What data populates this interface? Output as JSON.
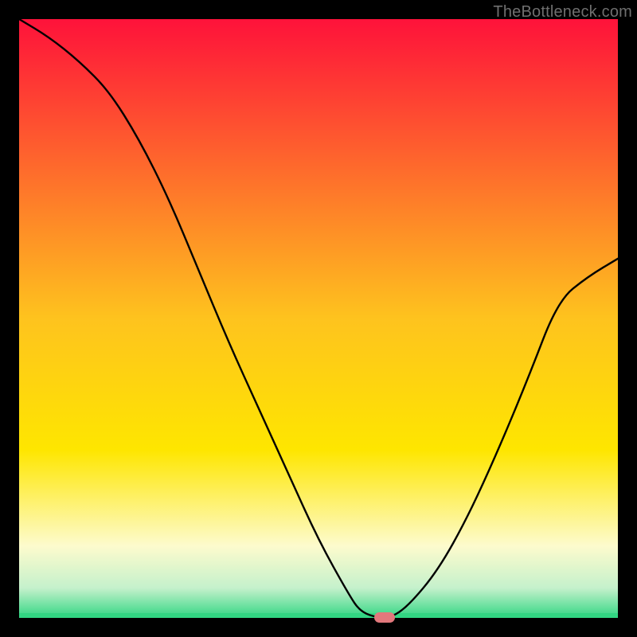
{
  "watermark": "TheBottleneck.com",
  "colors": {
    "bg": "#000000",
    "top_fill": "#fe123a",
    "mid_fill": "#fee600",
    "band_cream": "#fdfbcd",
    "band_mint": "#c5f1cc",
    "band_green": "#32d683",
    "curve": "#000000",
    "marker": "#e2787c",
    "watermark": "#6f6f6f"
  },
  "chart_data": {
    "type": "line",
    "title": "",
    "xlabel": "",
    "ylabel": "",
    "xlim": [
      0,
      100
    ],
    "ylim": [
      0,
      100
    ],
    "x": [
      0,
      5,
      10,
      15,
      20,
      25,
      30,
      35,
      40,
      45,
      50,
      55,
      57,
      60,
      62,
      65,
      70,
      75,
      80,
      85,
      90,
      95,
      100
    ],
    "y": [
      100,
      97,
      93,
      88,
      80,
      70,
      58,
      46,
      35,
      24,
      13,
      4,
      1,
      0,
      0,
      2,
      8,
      17,
      28,
      40,
      53,
      57,
      60
    ],
    "marker": {
      "x": 61,
      "y": 0
    },
    "gradient_bands": [
      {
        "pos": 0.0,
        "color": "#fe123a"
      },
      {
        "pos": 0.5,
        "color": "#fec31e"
      },
      {
        "pos": 0.72,
        "color": "#fee600"
      },
      {
        "pos": 0.88,
        "color": "#fdfbcd"
      },
      {
        "pos": 0.95,
        "color": "#c5f1cc"
      },
      {
        "pos": 1.0,
        "color": "#32d683"
      }
    ]
  }
}
